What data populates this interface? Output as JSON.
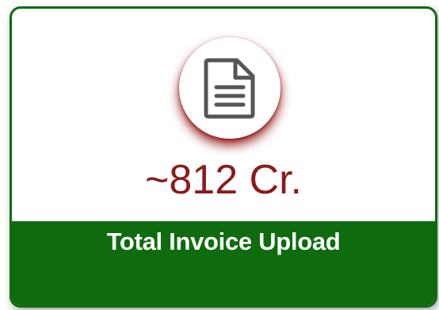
{
  "card": {
    "icon": "document-icon",
    "value": "~812 Cr.",
    "label": "Total Invoice Upload"
  },
  "colors": {
    "accent_green": "#0e6b0e",
    "value_red": "#8b1a1a",
    "shadow_red": "#8b0000"
  }
}
